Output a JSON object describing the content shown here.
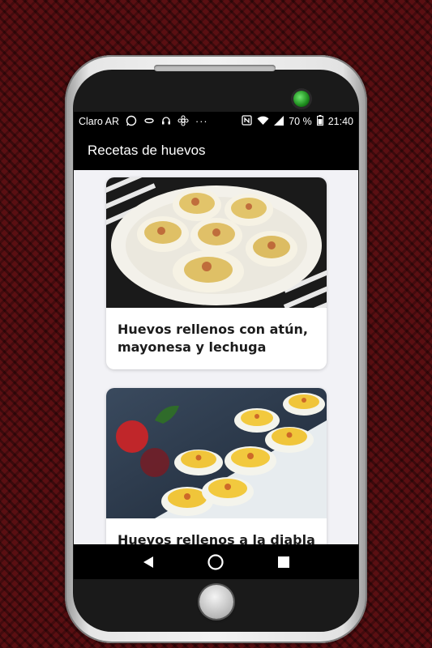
{
  "status_bar": {
    "carrier": "Claro AR",
    "battery": "70 %",
    "time": "21:40",
    "icons": [
      "whatsapp-icon",
      "bluetooth-headset-icon",
      "headphones-icon",
      "settings-icon",
      "more-icon",
      "nfc-icon",
      "wifi-icon",
      "signal-icon",
      "battery-icon"
    ]
  },
  "app_bar": {
    "title": "Recetas de huevos"
  },
  "recipes": [
    {
      "title": "Huevos rellenos con atún, mayonesa y lechuga"
    },
    {
      "title": "Huevos rellenos a la diabla"
    }
  ],
  "colors": {
    "background": "#5a0f12",
    "app_bar": "#000000",
    "card": "#ffffff",
    "screen_bg": "#f2f2f6"
  }
}
